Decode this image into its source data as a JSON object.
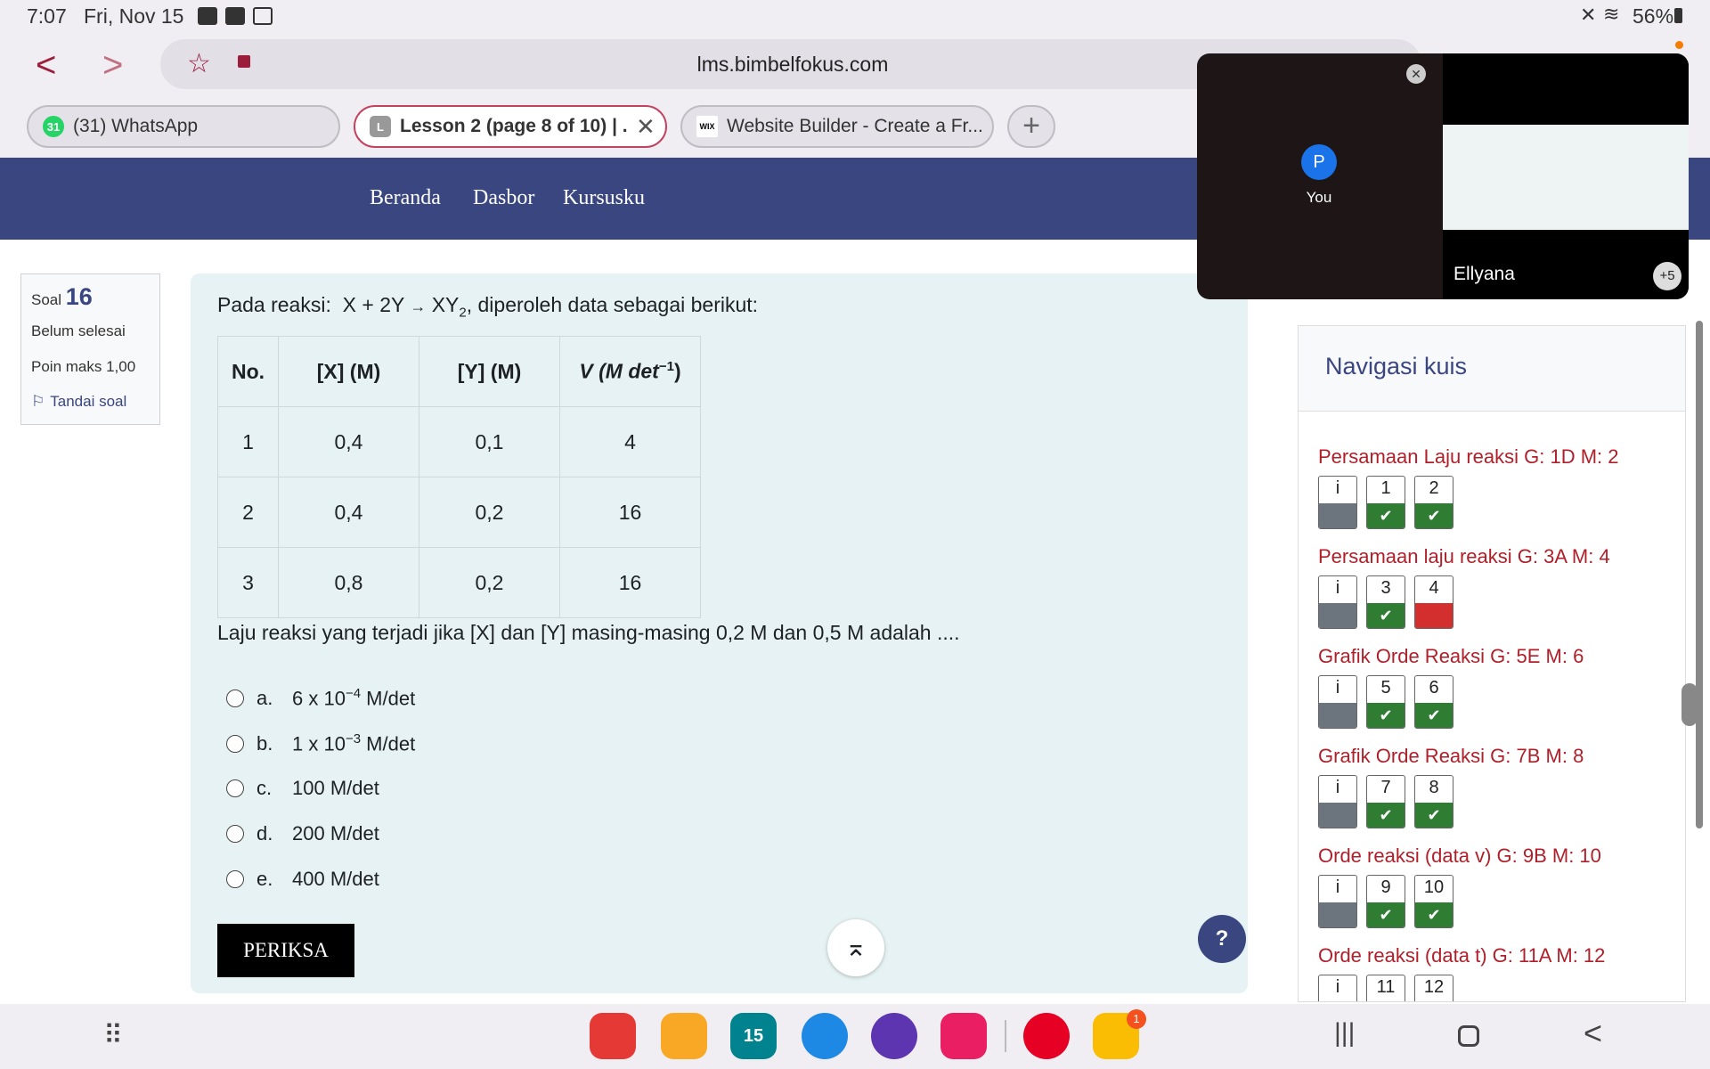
{
  "status_bar": {
    "time": "7:07",
    "date": "Fri, Nov 15",
    "battery": "56%"
  },
  "browser": {
    "url": "lms.bimbelfokus.com",
    "tabs": [
      {
        "label": "(31) WhatsApp",
        "badge": "31"
      },
      {
        "label": "Lesson 2 (page 8 of 10) | ...",
        "favicon_letter": "L"
      },
      {
        "label": "Website Builder - Create a Fr...",
        "favicon_text": "WIX"
      }
    ]
  },
  "site_nav": {
    "links": [
      "Beranda",
      "Dasbor",
      "Kursusku"
    ]
  },
  "question_info": {
    "label": "Soal",
    "number": "16",
    "status": "Belum selesai",
    "max_points": "Poin maks 1,00",
    "flag": "Tandai soal"
  },
  "question": {
    "intro": "Pada reaksi:",
    "reaction_lhs": "X + 2Y",
    "arrow": "→",
    "product": "XY",
    "product_sub": "2",
    "intro_tail": ", diperoleh data sebagai berikut:",
    "table": {
      "headers": [
        "No.",
        "[X] (M)",
        "[Y] (M)",
        "V (M det",
        "−1",
        ")"
      ],
      "rows": [
        [
          "1",
          "0,4",
          "0,1",
          "4"
        ],
        [
          "2",
          "0,4",
          "0,2",
          "16"
        ],
        [
          "3",
          "0,8",
          "0,2",
          "16"
        ]
      ]
    },
    "prompt": "Laju reaksi yang terjadi jika [X] dan [Y] masing-masing 0,2 M dan 0,5 M adalah ....",
    "options": [
      {
        "letter": "a.",
        "pre": "6 x 10",
        "sup": "−4",
        "post": " M/det"
      },
      {
        "letter": "b.",
        "pre": "1 x 10",
        "sup": "−3",
        "post": " M/det"
      },
      {
        "letter": "c.",
        "pre": "100 M/det",
        "sup": "",
        "post": ""
      },
      {
        "letter": "d.",
        "pre": "200 M/det",
        "sup": "",
        "post": ""
      },
      {
        "letter": "e.",
        "pre": "400 M/det",
        "sup": "",
        "post": ""
      }
    ],
    "check_button": "PERIKSA",
    "help_button": "?"
  },
  "quiz_nav": {
    "title": "Navigasi kuis",
    "sections": [
      {
        "title": "Persamaan Laju reaksi G: 1D M: 2",
        "buttons": [
          {
            "label": "i",
            "state": "info"
          },
          {
            "label": "1",
            "state": "correct"
          },
          {
            "label": "2",
            "state": "correct"
          }
        ]
      },
      {
        "title": "Persamaan laju reaksi G: 3A M: 4",
        "buttons": [
          {
            "label": "i",
            "state": "info"
          },
          {
            "label": "3",
            "state": "correct"
          },
          {
            "label": "4",
            "state": "incorrect"
          }
        ]
      },
      {
        "title": "Grafik Orde Reaksi G: 5E M: 6",
        "buttons": [
          {
            "label": "i",
            "state": "info"
          },
          {
            "label": "5",
            "state": "correct"
          },
          {
            "label": "6",
            "state": "correct"
          }
        ]
      },
      {
        "title": "Grafik Orde Reaksi G: 7B M: 8",
        "buttons": [
          {
            "label": "i",
            "state": "info"
          },
          {
            "label": "7",
            "state": "correct"
          },
          {
            "label": "8",
            "state": "correct"
          }
        ]
      },
      {
        "title": "Orde reaksi (data v) G: 9B M: 10",
        "buttons": [
          {
            "label": "i",
            "state": "info"
          },
          {
            "label": "9",
            "state": "correct"
          },
          {
            "label": "10",
            "state": "correct"
          }
        ]
      },
      {
        "title": "Orde reaksi (data t) G: 11A M: 12",
        "buttons": [
          {
            "label": "i",
            "state": "info"
          },
          {
            "label": "11",
            "state": "correct"
          },
          {
            "label": "12",
            "state": "correct"
          }
        ]
      }
    ]
  },
  "video_call": {
    "self_initial": "P",
    "self_label": "You",
    "participant": "Ellyana",
    "more": "+5"
  },
  "taskbar": {
    "calendar_day": "15",
    "meet_badge": "1"
  },
  "colors": {
    "nav_bg": "#3a4680",
    "panel_bg": "#e6f2f3",
    "correct": "#2e7d32",
    "incorrect": "#d32f2f",
    "info": "#6c757d",
    "section_title": "#b0202a"
  }
}
